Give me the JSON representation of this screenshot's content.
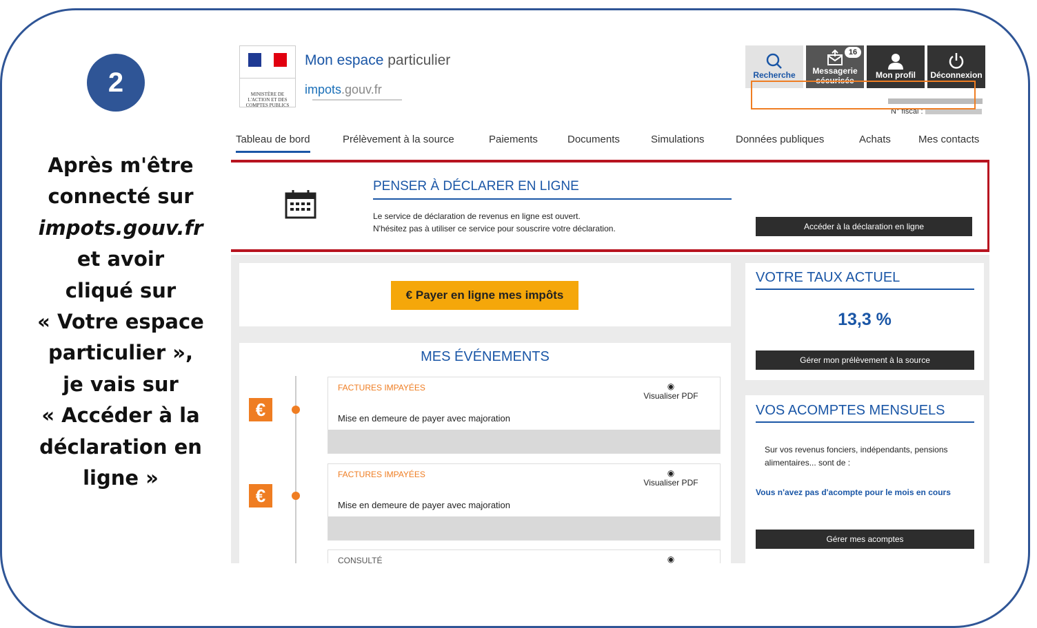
{
  "tutorial": {
    "step_number": "2",
    "instruction_lines": [
      "Après m'être",
      "connecté sur",
      "impots.gouv.fr",
      "et avoir",
      "cliqué sur",
      "« Votre espace",
      "particulier »,",
      "je vais sur",
      "« Accéder à la",
      "déclaration en",
      "ligne »"
    ]
  },
  "header": {
    "ministry_label": "MINISTÈRE DE L'ACTION ET DES COMPTES PUBLICS",
    "title_main": "Mon espace",
    "title_sub": "particulier",
    "url_main": "impots",
    "url_rest": ".gouv.fr",
    "buttons": [
      {
        "label_line1": "Recherche",
        "label_line2": "",
        "icon": "search-icon"
      },
      {
        "label_line1": "Messagerie",
        "label_line2": "sécurisée",
        "icon": "envelope-icon",
        "badge": "16"
      },
      {
        "label_line1": "Mon profil",
        "label_line2": "",
        "icon": "user-icon"
      },
      {
        "label_line1": "Déconnexion",
        "label_line2": "",
        "icon": "power-icon"
      }
    ],
    "fiscal_label": "N° fiscal :"
  },
  "nav": {
    "items": [
      "Tableau de bord",
      "Prélèvement à la source",
      "Paiements",
      "Documents",
      "Simulations",
      "Données publiques",
      "Achats",
      "Mes contacts"
    ]
  },
  "alert": {
    "title": "PENSER À DÉCLARER EN LIGNE",
    "line1": "Le service de déclaration de revenus en ligne est ouvert.",
    "line2": "N'hésitez pas à utiliser ce service pour souscrire votre déclaration.",
    "button": "Accéder à la déclaration en ligne"
  },
  "payment": {
    "button": "€  Payer en ligne mes impôts"
  },
  "rate": {
    "title": "VOTRE TAUX ACTUEL",
    "value": "13,3 %",
    "button": "Gérer mon prélèvement à la source"
  },
  "acomptes": {
    "title": "VOS ACOMPTES MENSUELS",
    "text": "Sur vos revenus fonciers, indépendants, pensions alimentaires... sont de :",
    "link": "Vous n'avez pas d'acompte pour le mois en cours",
    "button": "Gérer mes acomptes"
  },
  "events": {
    "title": "MES ÉVÉNEMENTS",
    "items": [
      {
        "category": "FACTURES IMPAYÉES",
        "description": "Mise en demeure de payer avec majoration",
        "view_label": "Visualiser  PDF"
      },
      {
        "category": "FACTURES IMPAYÉES",
        "description": "Mise en demeure de payer avec majoration",
        "view_label": "Visualiser  PDF"
      },
      {
        "category": "CONSULTÉ",
        "description": "",
        "view_label": ""
      }
    ]
  },
  "colors": {
    "frame": "#2f5596",
    "brand_blue": "#1a56a6",
    "alert_red": "#b81420",
    "highlight_orange": "#ef7d22",
    "pay_yellow": "#f5a70a"
  }
}
